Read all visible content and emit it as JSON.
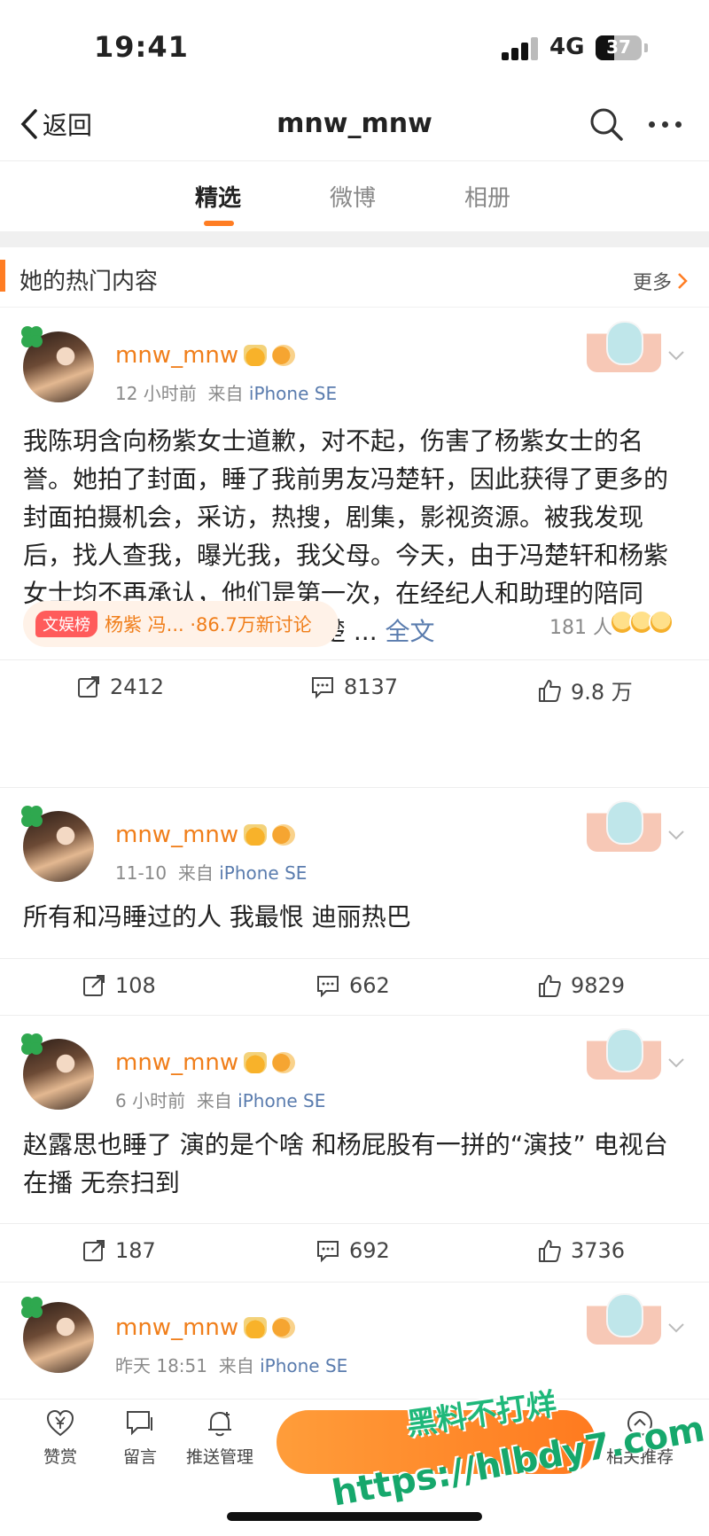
{
  "status_bar": {
    "time": "19:41",
    "network": "4G",
    "battery": "37"
  },
  "nav": {
    "back_label": "返回",
    "title": "mnw_mnw"
  },
  "tabs": [
    {
      "label": "精选",
      "active": true
    },
    {
      "label": "微博",
      "active": false
    },
    {
      "label": "相册",
      "active": false
    }
  ],
  "section": {
    "title": "她的热门内容",
    "more_label": "更多"
  },
  "posts": [
    {
      "username": "mnw_mnw",
      "time": "12 小时前",
      "from_label": "来自",
      "source": "iPhone SE",
      "text": "我陈玥含向杨紫女士道歉，对不起，伤害了杨紫女士的名誉。她拍了封面，睡了我前男友冯楚轩，因此获得了更多的封面拍摄机会，采访，热搜，剧集，影视资源。被我发现后，找人查我，曝光我，我父母。今天，由于冯楚轩和杨紫女士均不再承认，他们是第一次，在经纪人和助理的陪同下，由杨紫一方主动，约冯楚 ...",
      "full_text_label": "全文",
      "hot_tag": "文娱榜",
      "hot_text": "杨紫 冯... ·86.7万新讨论",
      "react_count": "181 人",
      "repost": "2412",
      "comment": "8137",
      "like": "9.8 万"
    },
    {
      "username": "mnw_mnw",
      "time": "11-10",
      "from_label": "来自",
      "source": "iPhone SE",
      "text": "所有和冯睡过的人 我最恨 迪丽热巴",
      "repost": "108",
      "comment": "662",
      "like": "9829"
    },
    {
      "username": "mnw_mnw",
      "time": "6 小时前",
      "from_label": "来自",
      "source": "iPhone SE",
      "text": "赵露思也睡了 演的是个啥 和杨屁股有一拼的“演技” 电视台在播 无奈扫到",
      "repost": "187",
      "comment": "692",
      "like": "3736"
    },
    {
      "username": "mnw_mnw",
      "time": "昨天 18:51",
      "from_label": "来自",
      "source": "iPhone SE"
    }
  ],
  "bottom_bar": {
    "tip_label": "赞赏",
    "message_label": "留言",
    "push_label": "推送管理",
    "related_label": "相关推荐"
  },
  "watermark": {
    "line1": "黑料不打烊",
    "line2": "https://hlbdy7.com"
  },
  "colors": {
    "accent": "#ff7d23",
    "username": "#f07e1a",
    "link": "#5a7cae"
  }
}
